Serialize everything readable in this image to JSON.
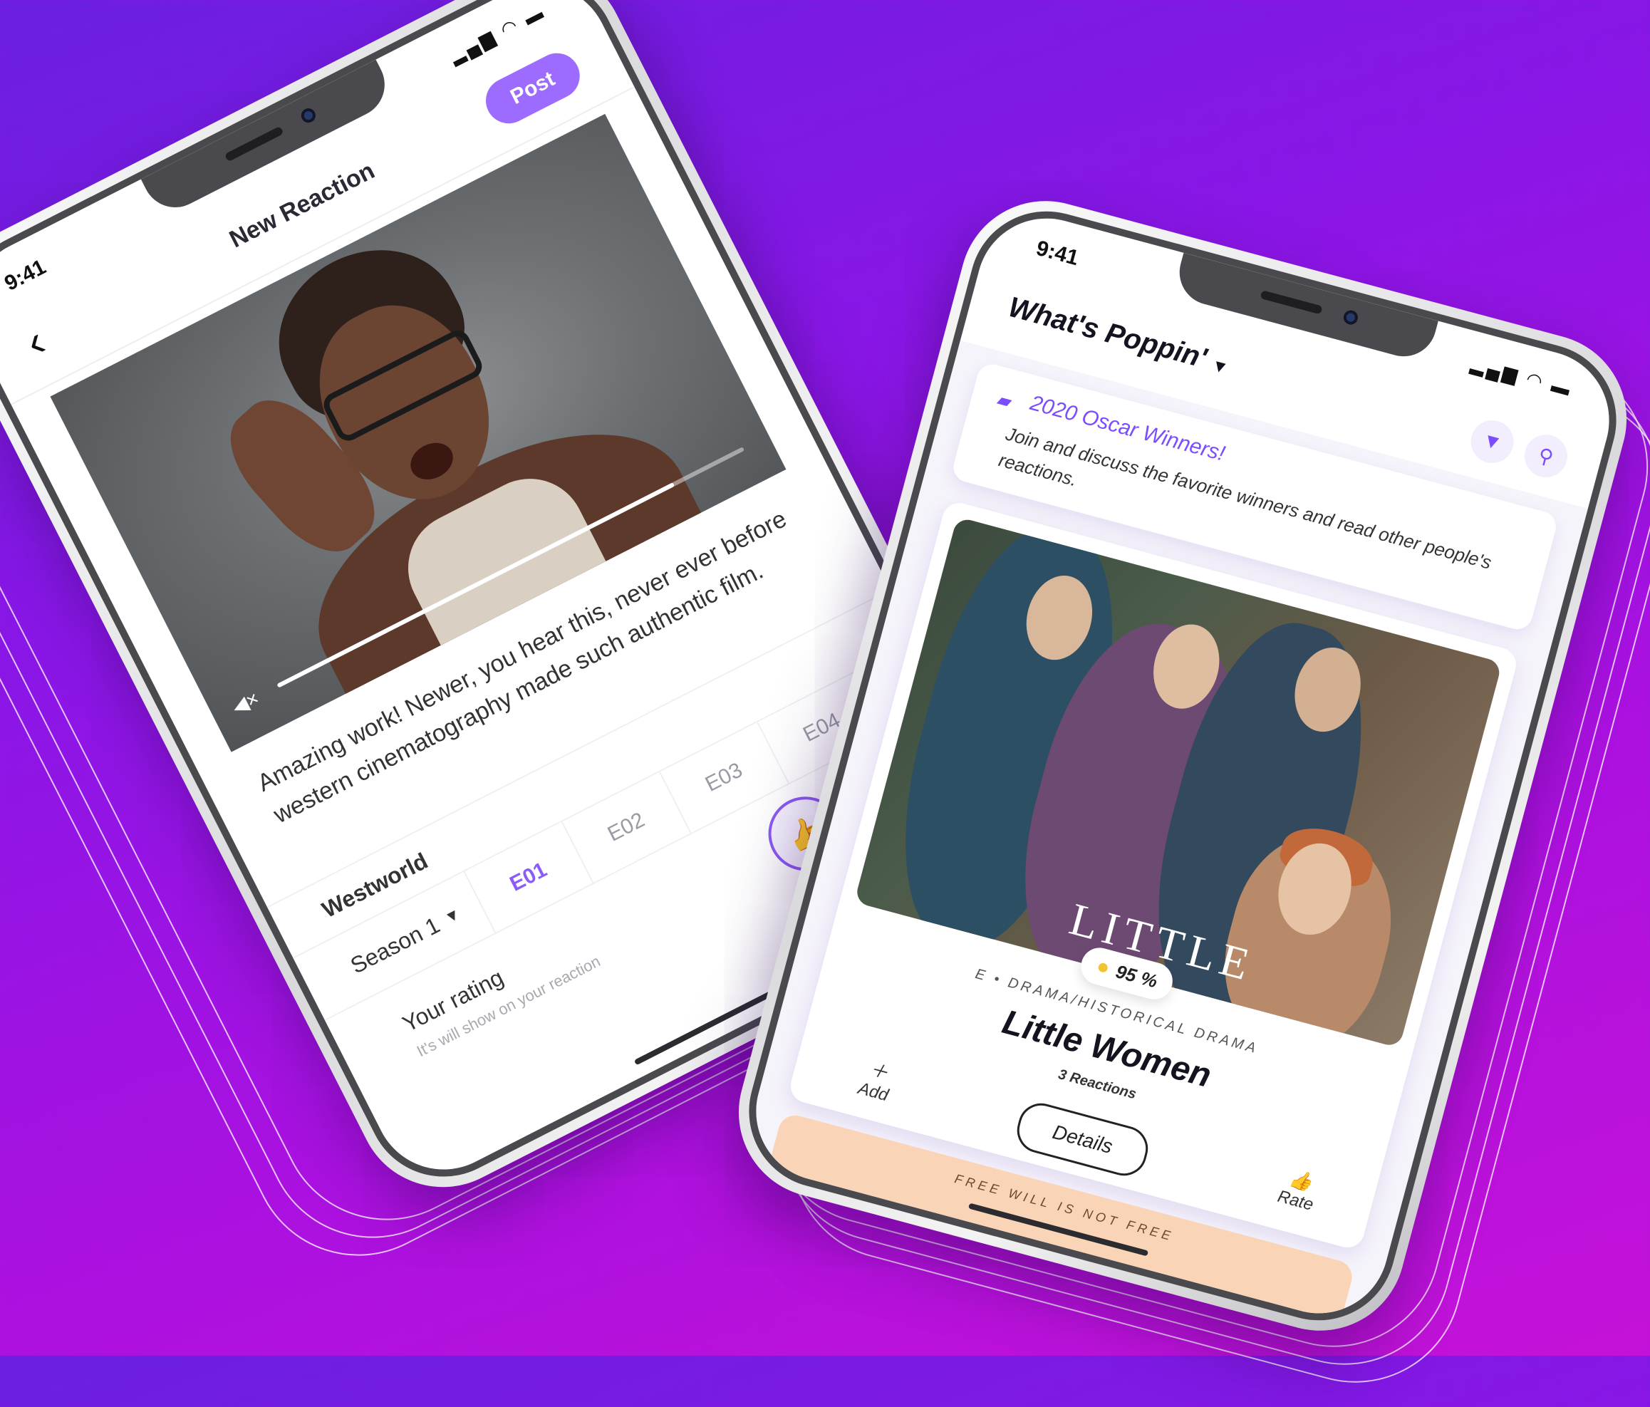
{
  "colors": {
    "accent": "#8b5cf6",
    "post_button": "#9d6bff",
    "background_gradient": [
      "#6b1fe0",
      "#c512d8"
    ]
  },
  "phone_left": {
    "status": {
      "time": "9:41",
      "icons": "signal wifi battery"
    },
    "header": {
      "back_icon": "chevron-left-icon",
      "title": "New Reaction",
      "post_label": "Post"
    },
    "video": {
      "mute_icon": "muted-speaker-icon",
      "progress": 0.85
    },
    "reaction_text": "Amazing work! Newer, you hear this, never ever before western cinematography made such authentic film.",
    "show_title": "Westworld",
    "season_label": "Season 1",
    "episodes": [
      {
        "label": "E01",
        "active": true
      },
      {
        "label": "E02",
        "active": false
      },
      {
        "label": "E03",
        "active": false
      },
      {
        "label": "E04",
        "active": false
      }
    ],
    "rating": {
      "title": "Your rating",
      "subtitle": "It's will show on your reaction"
    }
  },
  "phone_right": {
    "status": {
      "time": "9:41",
      "icons": "signal wifi battery"
    },
    "header": {
      "title": "What's Poppin'",
      "filter_icon": "filter-icon",
      "search_icon": "search-icon"
    },
    "promo": {
      "icon": "chat-bubble-icon",
      "title": "2020 Oscar Winners!",
      "text": "Join and discuss the favorite winners and read other people's reactions."
    },
    "movie": {
      "poster_title": "LITTLE",
      "score": "95 %",
      "genre": "E • DRAMA/HISTORICAL DRAMA",
      "title": "Little Women",
      "reactions": "3 Reactions",
      "add_label": "Add",
      "details_label": "Details",
      "rate_label": "Rate"
    },
    "next_card_text": "FREE WILL IS NOT FREE"
  }
}
